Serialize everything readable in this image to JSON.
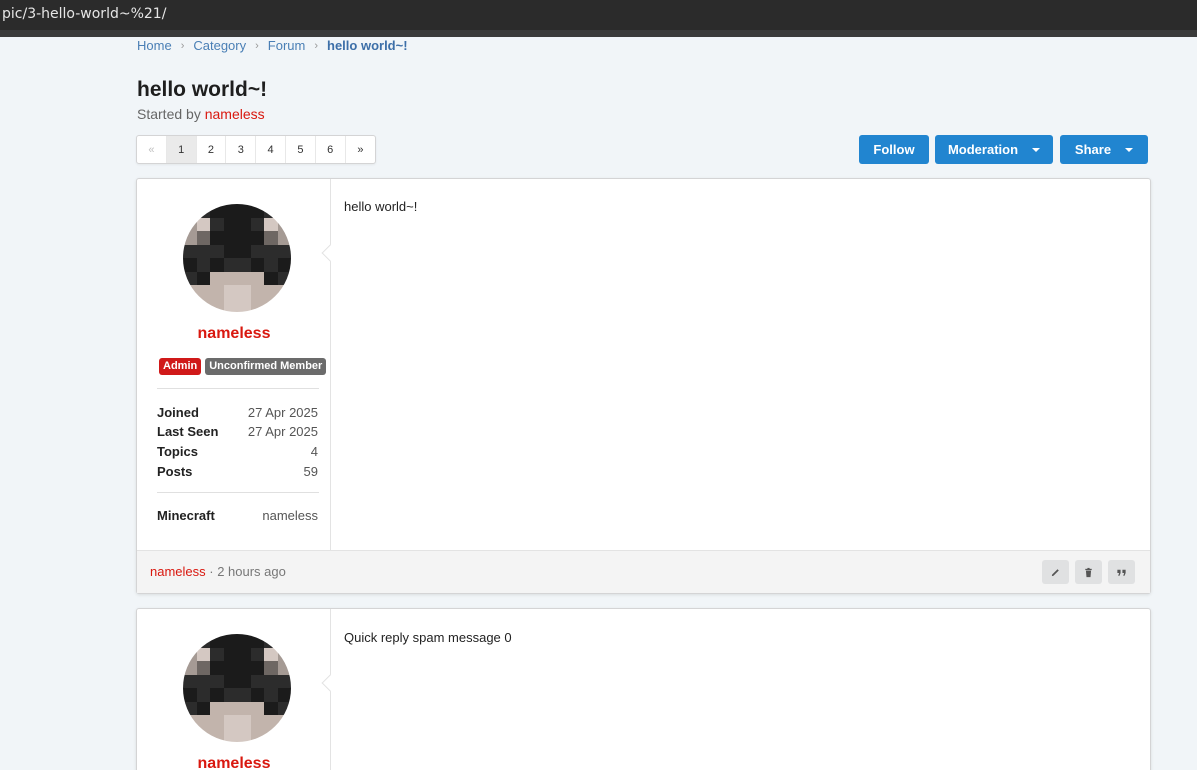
{
  "browser": {
    "url": "pic/3-hello-world~%21/"
  },
  "breadcrumb": {
    "home": "Home",
    "category": "Category",
    "forum": "Forum",
    "current": "hello world~!"
  },
  "topic": {
    "title": "hello world~!",
    "started_prefix": "Started by",
    "author": "nameless"
  },
  "pagination": {
    "prev": "«",
    "pages": [
      "1",
      "2",
      "3",
      "4",
      "5",
      "6"
    ],
    "next": "»",
    "current": "1"
  },
  "actions": {
    "follow": "Follow",
    "moderation": "Moderation",
    "share": "Share"
  },
  "posts": [
    {
      "username": "nameless",
      "badges": {
        "admin": "Admin",
        "unconfirmed": "Unconfirmed Member"
      },
      "stats": [
        {
          "label": "Joined",
          "value": "27 Apr 2025"
        },
        {
          "label": "Last Seen",
          "value": "27 Apr 2025"
        },
        {
          "label": "Topics",
          "value": "4"
        },
        {
          "label": "Posts",
          "value": "59"
        }
      ],
      "minecraft_label": "Minecraft",
      "minecraft_value": "nameless",
      "content": "hello world~!",
      "footer_author": "nameless",
      "footer_time": " · 2 hours ago"
    },
    {
      "username": "nameless",
      "content": "Quick reply spam message 0"
    }
  ],
  "colors": {
    "accent": "#2185d0",
    "username": "#d9180f",
    "admin_badge": "#d01919",
    "unconfirmed_badge": "#6b6b6b"
  }
}
